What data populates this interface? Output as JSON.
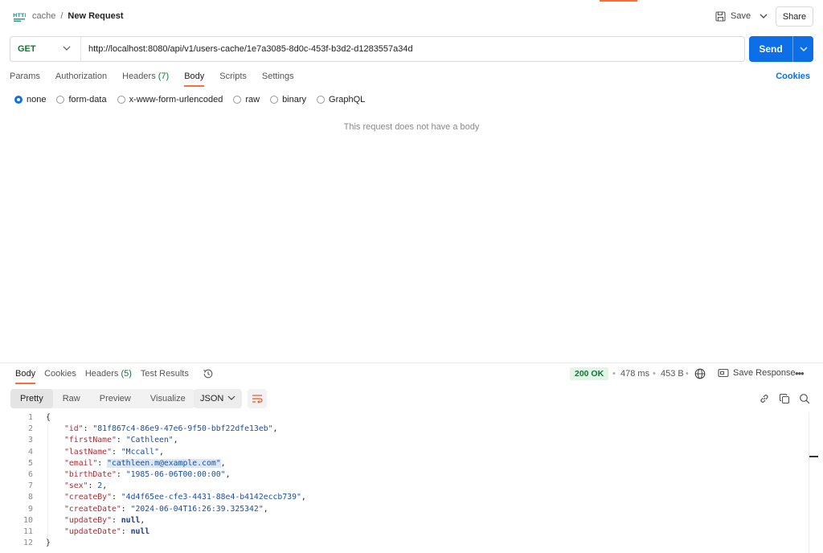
{
  "header": {
    "breadcrumb_parent": "cache",
    "breadcrumb_sep": "/",
    "request_name": "New Request",
    "save_label": "Save",
    "share_label": "Share"
  },
  "request": {
    "method": "GET",
    "url": "http://localhost:8080/api/v1/users-cache/1e7a3085-8d0c-453f-b3d2-d1283557a34d",
    "send_label": "Send",
    "tabs": [
      {
        "label": "Params"
      },
      {
        "label": "Authorization"
      },
      {
        "label": "Headers",
        "count": "(7)"
      },
      {
        "label": "Body",
        "active": true
      },
      {
        "label": "Scripts"
      },
      {
        "label": "Settings"
      }
    ],
    "cookies_label": "Cookies",
    "body_types": [
      "none",
      "form-data",
      "x-www-form-urlencoded",
      "raw",
      "binary",
      "GraphQL"
    ],
    "body_type_selected": "none",
    "no_body_message": "This request does not have a body"
  },
  "response": {
    "tabs": [
      {
        "label": "Body",
        "active": true
      },
      {
        "label": "Cookies"
      },
      {
        "label": "Headers",
        "count": "(5)"
      },
      {
        "label": "Test Results"
      }
    ],
    "status": "200 OK",
    "time": "478 ms",
    "size": "453 B",
    "save_response_label": "Save Response",
    "view_modes": [
      "Pretty",
      "Raw",
      "Preview",
      "Visualize"
    ],
    "view_mode_selected": "Pretty",
    "format": "JSON",
    "body_lines": [
      {
        "n": "1",
        "text": "{"
      },
      {
        "n": "2",
        "key": "\"id\"",
        "val": "\"81f867c4-86e9-47e6-9f50-bbf22dfe13eb\"",
        "type": "str",
        "comma": ","
      },
      {
        "n": "3",
        "key": "\"firstName\"",
        "val": "\"Cathleen\"",
        "type": "str",
        "comma": ","
      },
      {
        "n": "4",
        "key": "\"lastName\"",
        "val": "\"Mccall\"",
        "type": "str",
        "comma": ","
      },
      {
        "n": "5",
        "key": "\"email\"",
        "val": "\"cathleen.m@example.com\"",
        "type": "str",
        "comma": ",",
        "highlight": true
      },
      {
        "n": "6",
        "key": "\"birthDate\"",
        "val": "\"1985-06-06T00:00:00\"",
        "type": "str",
        "comma": ","
      },
      {
        "n": "7",
        "key": "\"sex\"",
        "val": "2",
        "type": "num",
        "comma": ","
      },
      {
        "n": "8",
        "key": "\"createBy\"",
        "val": "\"4d4f65ee-cfe3-4431-88e4-b4142eccb739\"",
        "type": "str",
        "comma": ","
      },
      {
        "n": "9",
        "key": "\"createDate\"",
        "val": "\"2024-06-04T16:26:39.325342\"",
        "type": "str",
        "comma": ","
      },
      {
        "n": "10",
        "key": "\"updateBy\"",
        "val": "null",
        "type": "kw",
        "comma": ","
      },
      {
        "n": "11",
        "key": "\"updateDate\"",
        "val": "null",
        "type": "kw",
        "comma": ""
      },
      {
        "n": "12",
        "text": "}"
      }
    ]
  },
  "colors": {
    "accent": "#ff6c37",
    "primary": "#0c6fe8",
    "success": "#0a7a2f"
  }
}
